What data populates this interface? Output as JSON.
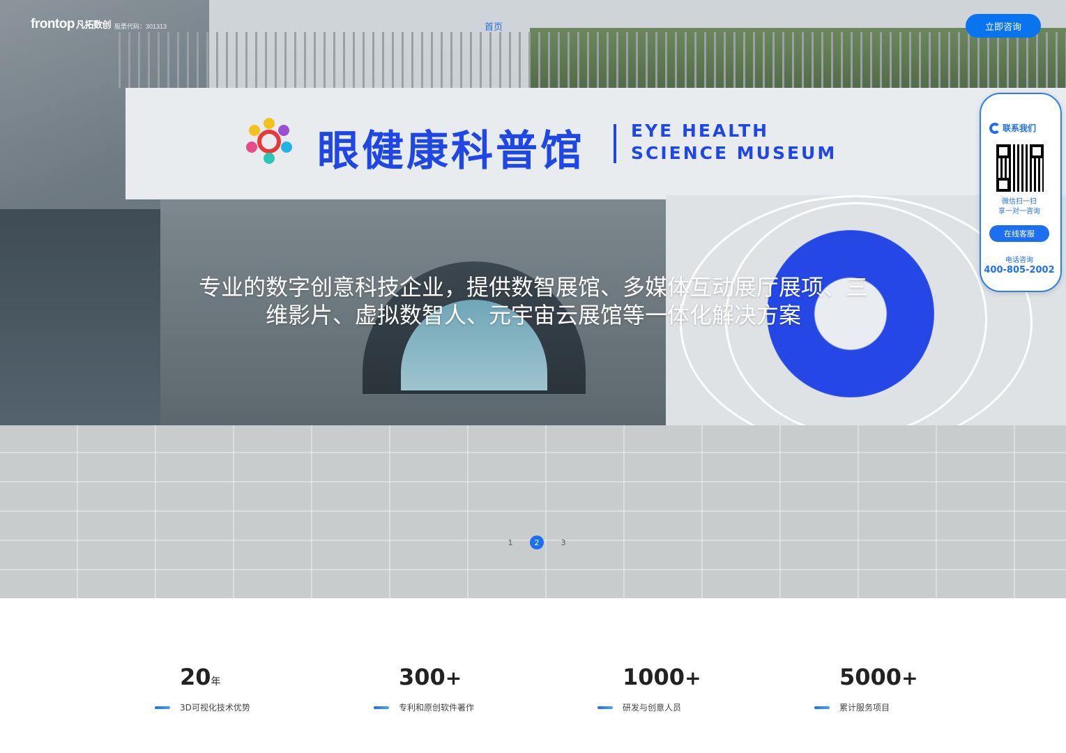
{
  "nav": {
    "logo_text": "frontop",
    "logo_cn": "凡拓数创",
    "stock_code": "股票代码：301313",
    "home_link": "首页",
    "consult_button": "立即咨询"
  },
  "hero": {
    "sign_cn": "眼健康科普馆",
    "sign_en_line1": "EYE HEALTH",
    "sign_en_line2": "SCIENCE MUSEUM",
    "headline": "专业的数字创意科技企业，提供数智展馆、多媒体互动展厅展项、三维影片、虚拟数智人、元宇宙云展馆等一体化解决方案",
    "slides": [
      "1",
      "2",
      "3"
    ],
    "active_slide": 2
  },
  "contact": {
    "title": "联系我们",
    "scan_line1": "微信扫一扫",
    "scan_line2": "享一对一咨询",
    "online_button": "在线客服",
    "phone_label": "电话咨询",
    "phone": "400-805-2002"
  },
  "stats": [
    {
      "num": "20",
      "unit": "年",
      "label": "3D可视化技术优势"
    },
    {
      "num": "300",
      "unit": "+",
      "label": "专利和原创软件著作"
    },
    {
      "num": "1000",
      "unit": "+",
      "label": "研发与创意人员"
    },
    {
      "num": "5000",
      "unit": "+",
      "label": "累计服务项目"
    }
  ],
  "colors": {
    "accent": "#1e6ff0",
    "sign_blue": "#1e47e6"
  }
}
